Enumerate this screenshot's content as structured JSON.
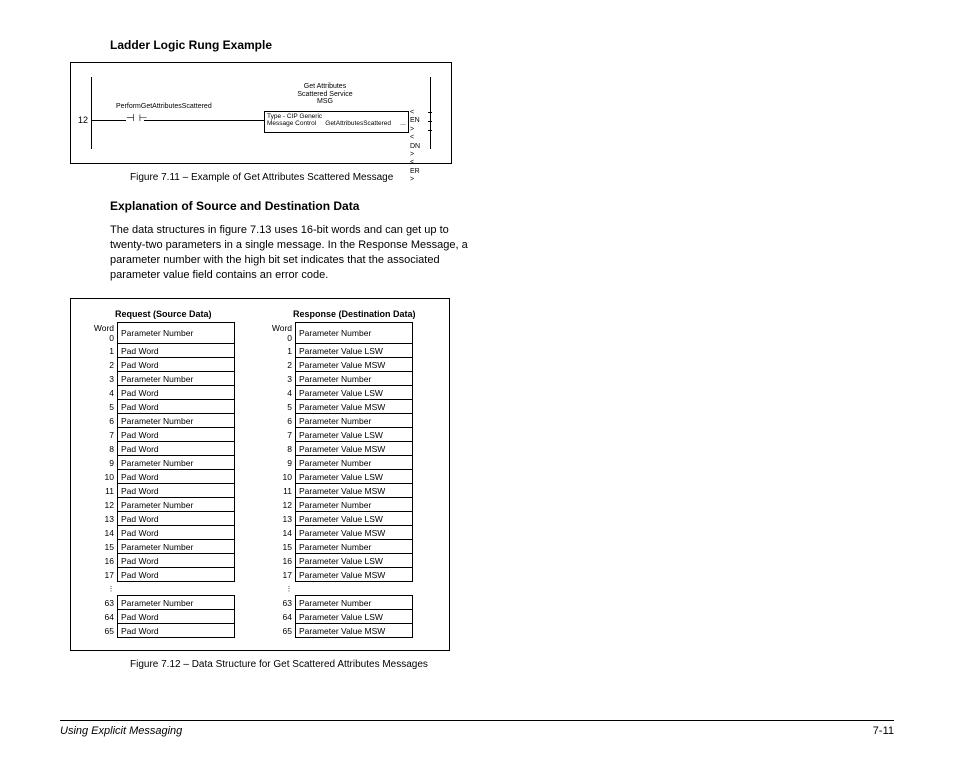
{
  "heading1": "Ladder Logic Rung Example",
  "ladder": {
    "rung_num": "12",
    "contact_label": "PerformGetAttributesScattered",
    "msg_title1": "Get Attributes",
    "msg_title2": "Scattered Service",
    "msg_title3": "MSG",
    "box_l1": "Type - CIP Generic",
    "box_l2": "Message Control",
    "box_r2": "GetAttributesScattered",
    "stat_en": "EN",
    "stat_dn": "DN",
    "stat_er": "ER"
  },
  "caption1": "Figure 7.11 – Example of Get Attributes Scattered Message",
  "heading2": "Explanation of Source and Destination Data",
  "para": "The data structures in figure 7.13 uses 16-bit words and can get up to twenty-two parameters in a single message. In the Response Message, a parameter number with the high bit set indicates that the associated parameter value field contains an error code.",
  "colA_head": "Request (Source Data)",
  "colB_head": "Response (Destination Data)",
  "word_prefix": "Word",
  "colA": [
    {
      "i": "0",
      "v": "Parameter Number"
    },
    {
      "i": "1",
      "v": "Pad Word"
    },
    {
      "i": "2",
      "v": "Pad Word"
    },
    {
      "i": "3",
      "v": "Parameter Number"
    },
    {
      "i": "4",
      "v": "Pad Word"
    },
    {
      "i": "5",
      "v": "Pad Word"
    },
    {
      "i": "6",
      "v": "Parameter Number"
    },
    {
      "i": "7",
      "v": "Pad Word"
    },
    {
      "i": "8",
      "v": "Pad Word"
    },
    {
      "i": "9",
      "v": "Parameter Number"
    },
    {
      "i": "10",
      "v": "Pad Word"
    },
    {
      "i": "11",
      "v": "Pad Word"
    },
    {
      "i": "12",
      "v": "Parameter Number"
    },
    {
      "i": "13",
      "v": "Pad Word"
    },
    {
      "i": "14",
      "v": "Pad Word"
    },
    {
      "i": "15",
      "v": "Parameter Number"
    },
    {
      "i": "16",
      "v": "Pad Word"
    },
    {
      "i": "17",
      "v": "Pad Word"
    },
    {
      "i": "⋮",
      "v": "",
      "ell": true
    },
    {
      "i": "63",
      "v": "Parameter Number"
    },
    {
      "i": "64",
      "v": "Pad Word"
    },
    {
      "i": "65",
      "v": "Pad Word"
    }
  ],
  "colB": [
    {
      "i": "0",
      "v": "Parameter Number"
    },
    {
      "i": "1",
      "v": "Parameter Value LSW"
    },
    {
      "i": "2",
      "v": "Parameter Value MSW"
    },
    {
      "i": "3",
      "v": "Parameter Number"
    },
    {
      "i": "4",
      "v": "Parameter Value LSW"
    },
    {
      "i": "5",
      "v": "Parameter Value MSW"
    },
    {
      "i": "6",
      "v": "Parameter Number"
    },
    {
      "i": "7",
      "v": "Parameter Value LSW"
    },
    {
      "i": "8",
      "v": "Parameter Value MSW"
    },
    {
      "i": "9",
      "v": "Parameter Number"
    },
    {
      "i": "10",
      "v": "Parameter Value LSW"
    },
    {
      "i": "11",
      "v": "Parameter Value MSW"
    },
    {
      "i": "12",
      "v": "Parameter Number"
    },
    {
      "i": "13",
      "v": "Parameter Value LSW"
    },
    {
      "i": "14",
      "v": "Parameter Value MSW"
    },
    {
      "i": "15",
      "v": "Parameter Number"
    },
    {
      "i": "16",
      "v": "Parameter Value LSW"
    },
    {
      "i": "17",
      "v": "Parameter Value MSW"
    },
    {
      "i": "⋮",
      "v": "",
      "ell": true
    },
    {
      "i": "63",
      "v": "Parameter Number"
    },
    {
      "i": "64",
      "v": "Parameter Value LSW"
    },
    {
      "i": "65",
      "v": "Parameter Value MSW"
    }
  ],
  "caption2": "Figure 7.12 – Data Structure for Get Scattered Attributes Messages",
  "footer_left": "Using Explicit Messaging",
  "footer_right": "7-11"
}
